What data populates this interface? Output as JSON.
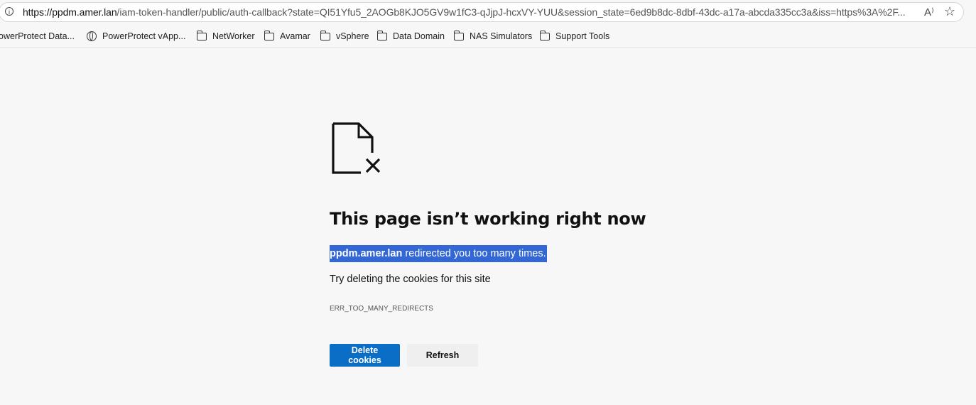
{
  "browser": {
    "url_host": "https://ppdm.amer.lan",
    "url_rest": "/iam-token-handler/public/auth-callback?state=QI51Yfu5_2AOGb8KJO5GV9w1fC3-qJjpJ-hcxVY-YUU&session_state=6ed9b8dc-8dbf-43dc-a17a-abcda335cc3a&iss=https%3A%2F...",
    "read_aloud_glyph": "A⁾",
    "bookmarks": [
      {
        "label": "owerProtect Data...",
        "icon": "none"
      },
      {
        "label": "PowerProtect vApp...",
        "icon": "globe-icon"
      },
      {
        "label": "NetWorker",
        "icon": "folder-icon"
      },
      {
        "label": "Avamar",
        "icon": "folder-icon"
      },
      {
        "label": "vSphere",
        "icon": "folder-icon"
      },
      {
        "label": "Data Domain",
        "icon": "folder-icon"
      },
      {
        "label": "NAS Simulators",
        "icon": "folder-icon"
      },
      {
        "label": "Support Tools",
        "icon": "folder-icon"
      }
    ]
  },
  "error": {
    "title": "This page isn’t working right now",
    "host": "ppdm.amer.lan",
    "message": " redirected you too many times.",
    "hint": "Try deleting the cookies for this site",
    "code": "ERR_TOO_MANY_REDIRECTS",
    "delete_label": "Delete cookies",
    "refresh_label": "Refresh"
  },
  "colors": {
    "primary": "#0a6ec7",
    "selection": "#3367d6"
  }
}
